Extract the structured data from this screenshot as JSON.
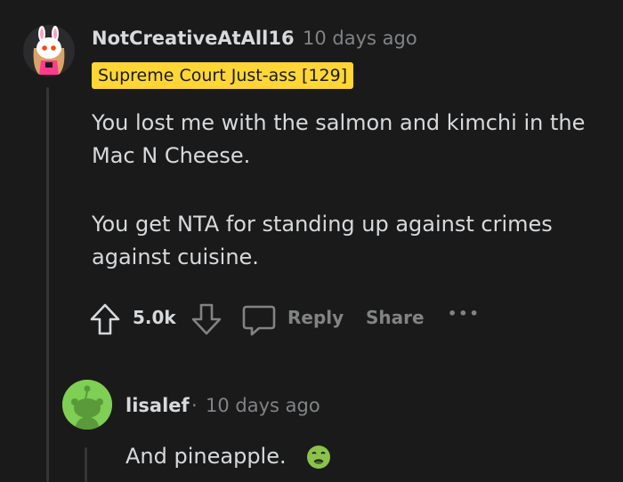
{
  "comment": {
    "username": "NotCreativeAtAll16",
    "separator": "·",
    "timestamp": "10 days ago",
    "flair": "Supreme Court Just-ass [129]",
    "paragraphs": [
      "You lost me with the salmon and kimchi in the Mac N Cheese.",
      "You get NTA for standing up against crimes against cuisine."
    ],
    "votes": "5.0k",
    "reply_label": "Reply",
    "share_label": "Share",
    "more_label": "•••"
  },
  "reply": {
    "username": "lisalef",
    "separator": "·",
    "timestamp": "10 days ago",
    "body": "And pineapple.",
    "emoji_icon": "nauseated-face-icon"
  },
  "colors": {
    "background": "#1a1a1b",
    "text": "#d7dadc",
    "muted": "#818384",
    "flair_bg": "#ffd635",
    "reply_avatar_bg": "#7ecf54"
  }
}
